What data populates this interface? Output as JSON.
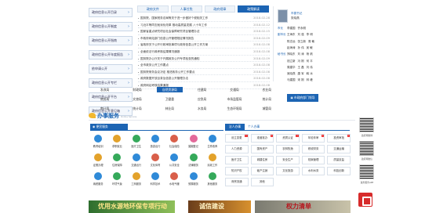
{
  "left_nav": [
    {
      "label": "政府信息公开目录"
    },
    {
      "label": "政府信息公开制度"
    },
    {
      "label": "政府信息公开指南"
    },
    {
      "label": "政府信息公开年度报告"
    },
    {
      "label": "依申请公开"
    },
    {
      "label": "政府信息公开专栏"
    },
    {
      "label": "政府信息公开平台"
    },
    {
      "label": "政府信息公开意见箱"
    }
  ],
  "tabs": [
    {
      "label": "政府文件"
    },
    {
      "label": "人事任免"
    },
    {
      "label": "政府规章"
    },
    {
      "label": "政策解读"
    }
  ],
  "news": [
    {
      "title": "国务院、国家税务总局等关于进一步做好个税相关工作",
      "date": "2018-02-28"
    },
    {
      "title": "习近平等同志就深化改革 推动高质量发展 八十年工作",
      "date": "2018-02-12"
    },
    {
      "title": "国家省重点研究项目社会保障研究项目管理办法",
      "date": "2018-02-15"
    },
    {
      "title": "市政府网站部门信息公开管理规定情况报告",
      "date": "2018-02-09"
    },
    {
      "title": "省政府关于公开行政审批事项与政府信息公开工作方案",
      "date": "2018-02-08"
    },
    {
      "title": "全面依法行政考核结果情况通报",
      "date": "2018-02-08"
    },
    {
      "title": "国务院办公厅关于开展政务公开专项检查的通知",
      "date": "2018-02-09"
    },
    {
      "title": "全市政务公开工作要点",
      "date": "2018-02-08"
    },
    {
      "title": "国务院常务会议决定 推进政务公开工作要点",
      "date": "2018-02-08"
    },
    {
      "title": "政府数据开放目录及信息公开管理办法",
      "date": "2018-02-08"
    },
    {
      "title": "政府网站考核结果通报",
      "date": "2018-02-08"
    }
  ],
  "leaders": {
    "role": "市委书记",
    "name": "张晓燕",
    "rows": [
      {
        "role": "市长",
        "names": [
          "李建国",
          "齐永刚"
        ]
      },
      {
        "role": "副市长",
        "names": [
          "王海东",
          "刘 强",
          "李 明"
        ]
      },
      {
        "role": "",
        "names": [
          "陈志远",
          "张立新",
          "周 敏"
        ]
      },
      {
        "role": "",
        "names": [
          "赵海涛",
          "孙 伟",
          "吴 敏"
        ]
      },
      {
        "role": "秘书长",
        "names": [
          "郑晓东",
          "刘 涛",
          "杨 帆"
        ]
      },
      {
        "role": "",
        "names": [
          "钱立新",
          "冯 刚",
          "何 平"
        ]
      },
      {
        "role": "",
        "names": [
          "周建华",
          "王 磊",
          "刘 伟"
        ]
      },
      {
        "role": "",
        "names": [
          "吴晓燕",
          "唐 军",
          "韩 冰"
        ]
      },
      {
        "role": "",
        "names": [
          "马建国",
          "宋 刚",
          "林 峰"
        ]
      }
    ]
  },
  "departments": [
    [
      "发改局",
      "财政局",
      "自然资源局",
      "住建局",
      "交通局",
      "农业局"
    ],
    [
      "商务局",
      "文旅局",
      "卫健委",
      "应急局",
      "市场监管局",
      "统计局"
    ],
    [
      "审计局",
      "统计局",
      "林业局",
      "水务局",
      "生态环境局",
      "城管局"
    ]
  ],
  "selected_department": "自然资源局",
  "contact_button": "市政府部门领导",
  "service_hall": {
    "title": "办事服务",
    "subtitle": "Online Service"
  },
  "convenience_tab": "便民服务",
  "services": [
    {
      "label": "教育培训",
      "color": "#2f8ad8"
    },
    {
      "label": "求职就业",
      "color": "#e3a22b"
    },
    {
      "label": "医疗卫生",
      "color": "#35a95a"
    },
    {
      "label": "旅游出行",
      "color": "#2f8ad8"
    },
    {
      "label": "社会保险",
      "color": "#d95f4a"
    },
    {
      "label": "婚姻登记",
      "color": "#e36a9a"
    },
    {
      "label": "生育收养",
      "color": "#2f8ad8"
    },
    {
      "label": "证照办理",
      "color": "#e3a22b"
    },
    {
      "label": "住房保障",
      "color": "#35a95a"
    },
    {
      "label": "交通出行",
      "color": "#2f8ad8"
    },
    {
      "label": "文化体育",
      "color": "#d95f4a"
    },
    {
      "label": "公共安全",
      "color": "#2f8ad8"
    },
    {
      "label": "法律服务",
      "color": "#35a95a"
    },
    {
      "label": "民政工作",
      "color": "#e3a22b"
    },
    {
      "label": "纳税服务",
      "color": "#2f8ad8"
    },
    {
      "label": "环境气象",
      "color": "#35a95a"
    },
    {
      "label": "工商服务",
      "color": "#e3a22b"
    },
    {
      "label": "科学技术",
      "color": "#2f8ad8"
    },
    {
      "label": "水电气暖",
      "color": "#d95f4a"
    },
    {
      "label": "殡葬服务",
      "color": "#2f8ad8"
    },
    {
      "label": "其他服务",
      "color": "#35a95a"
    }
  ],
  "legal_tab": "法人办事",
  "personal_tab": "个人办事",
  "themes": [
    {
      "label": "设立变更",
      "hot": true
    },
    {
      "label": "准营准办",
      "hot": true
    },
    {
      "label": "资质认证",
      "hot": true
    },
    {
      "label": "年检年审",
      "hot": true
    },
    {
      "label": "投资审批",
      "hot": true
    },
    {
      "label": "人力资源",
      "hot": false
    },
    {
      "label": "国有资产",
      "hot": false
    },
    {
      "label": "农林牧渔",
      "hot": false
    },
    {
      "label": "税收财务",
      "hot": false
    },
    {
      "label": "交通运输",
      "hot": false
    },
    {
      "label": "医疗卫生",
      "hot": false
    },
    {
      "label": "城建住房",
      "hot": false
    },
    {
      "label": "安全生产",
      "hot": false
    },
    {
      "label": "档案管理",
      "hot": false
    },
    {
      "label": "质量技监",
      "hot": false
    },
    {
      "label": "知识产权",
      "hot": false
    },
    {
      "label": "破产注销",
      "hot": false
    },
    {
      "label": "文化旅游",
      "hot": false
    },
    {
      "label": "水利水务",
      "hot": false
    },
    {
      "label": "科技创新",
      "hot": false
    },
    {
      "label": "商贸流通",
      "hot": false
    },
    {
      "label": "其他",
      "hot": false
    }
  ],
  "qr_labels": [
    "政府网微博",
    "政府网微信",
    "政务服务APP"
  ],
  "banners": [
    {
      "text": "优用水源地环保专项行动",
      "color": "#fde68a"
    },
    {
      "text": "诚信建设",
      "color": "#fff3c4"
    },
    {
      "text": "权力清单",
      "color": "#b8131b"
    }
  ],
  "accent": "#1c64b3"
}
